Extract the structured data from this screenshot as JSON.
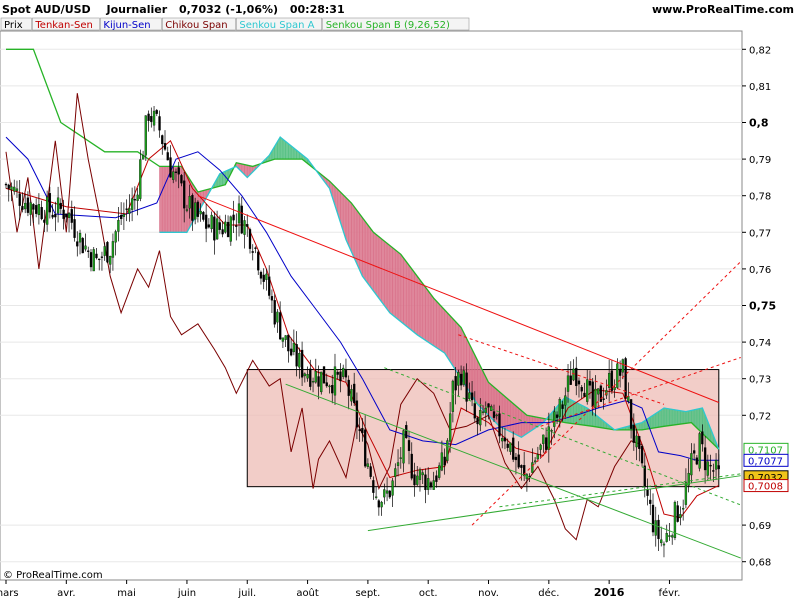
{
  "header": {
    "instrument": "Spot AUD/USD",
    "period": "Journalier",
    "last": "0,7032 (-1,06%)",
    "time": "00:28:31",
    "site": "www.ProRealTime.com"
  },
  "legend": [
    {
      "label": "Prix",
      "color": "#000000"
    },
    {
      "label": "Tenkan-Sen",
      "color": "#c00000"
    },
    {
      "label": "Kijun-Sen",
      "color": "#0000c8"
    },
    {
      "label": "Chikou Span",
      "color": "#7a0000"
    },
    {
      "label": "Senkou Span A",
      "color": "#2ec7d0"
    },
    {
      "label": "Senkou Span B (9,26,52)",
      "color": "#27b327"
    }
  ],
  "copyright": "© ProRealTime.com",
  "colors": {
    "bull": "#1a9a1a",
    "bear": "#000000",
    "cloud_bear": "#d9728a",
    "cloud_bull": "#55c083",
    "span_a": "#2ec7d0",
    "span_b": "#27b327",
    "tenkan": "#c00000",
    "kijun": "#0000c8",
    "chikou": "#7a0000",
    "range_box": "#eebcb6",
    "trend_red": "#ee1111",
    "trend_green": "#33aa33"
  },
  "chart_data": {
    "type": "candlestick",
    "x_labels": [
      "mars",
      "avr.",
      "mai",
      "juin",
      "juil.",
      "août",
      "sept.",
      "oct.",
      "nov.",
      "déc.",
      "2016",
      "févr."
    ],
    "y_range": [
      0.675,
      0.825
    ],
    "y_ticks": [
      {
        "label": "0,82",
        "value": 0.82,
        "bold": false
      },
      {
        "label": "0,81",
        "value": 0.81,
        "bold": false
      },
      {
        "label": "0,8",
        "value": 0.8,
        "bold": true
      },
      {
        "label": "0,79",
        "value": 0.79,
        "bold": false
      },
      {
        "label": "0,78",
        "value": 0.78,
        "bold": false
      },
      {
        "label": "0,77",
        "value": 0.77,
        "bold": false
      },
      {
        "label": "0,76",
        "value": 0.76,
        "bold": false
      },
      {
        "label": "0,75",
        "value": 0.75,
        "bold": true
      },
      {
        "label": "0,74",
        "value": 0.74,
        "bold": false
      },
      {
        "label": "0,73",
        "value": 0.73,
        "bold": false
      },
      {
        "label": "0,72",
        "value": 0.72,
        "bold": false
      },
      {
        "label": "0,69",
        "value": 0.69,
        "bold": false
      },
      {
        "label": "0,68",
        "value": 0.68,
        "bold": false
      }
    ],
    "badges": [
      {
        "label": "0,7107",
        "value": 0.7107,
        "bg": "#ffffff",
        "fg": "#27b327",
        "border": "#27b327"
      },
      {
        "label": "0,7077",
        "value": 0.7077,
        "bg": "#ffffff",
        "fg": "#0000c8",
        "border": "#0000c8"
      },
      {
        "label": "0,7032",
        "value": 0.7032,
        "bg": "#f0c419",
        "fg": "#000000",
        "border": "#000000"
      },
      {
        "label": "0,7008",
        "value": 0.7008,
        "bg": "#ffffff",
        "fg": "#c00000",
        "border": "#c00000"
      }
    ],
    "month_index": [
      0,
      22,
      44,
      66,
      88,
      110,
      132,
      154,
      176,
      198,
      220,
      242
    ],
    "total_bars": 268,
    "close_anchors": [
      [
        0,
        0.783
      ],
      [
        8,
        0.778
      ],
      [
        15,
        0.776
      ],
      [
        22,
        0.776
      ],
      [
        28,
        0.767
      ],
      [
        33,
        0.762
      ],
      [
        38,
        0.766
      ],
      [
        42,
        0.774
      ],
      [
        47,
        0.779
      ],
      [
        52,
        0.803
      ],
      [
        56,
        0.798
      ],
      [
        60,
        0.788
      ],
      [
        64,
        0.781
      ],
      [
        68,
        0.775
      ],
      [
        73,
        0.772
      ],
      [
        78,
        0.771
      ],
      [
        85,
        0.775
      ],
      [
        90,
        0.768
      ],
      [
        94,
        0.758
      ],
      [
        98,
        0.748
      ],
      [
        103,
        0.738
      ],
      [
        108,
        0.733
      ],
      [
        113,
        0.731
      ],
      [
        118,
        0.73
      ],
      [
        124,
        0.729
      ],
      [
        128,
        0.718
      ],
      [
        132,
        0.707
      ],
      [
        135,
        0.699
      ],
      [
        138,
        0.697
      ],
      [
        141,
        0.701
      ],
      [
        145,
        0.712
      ],
      [
        149,
        0.704
      ],
      [
        152,
        0.703
      ],
      [
        155,
        0.702
      ],
      [
        160,
        0.707
      ],
      [
        163,
        0.727
      ],
      [
        166,
        0.732
      ],
      [
        169,
        0.724
      ],
      [
        172,
        0.716
      ],
      [
        175,
        0.722
      ],
      [
        178,
        0.717
      ],
      [
        182,
        0.715
      ],
      [
        186,
        0.708
      ],
      [
        189,
        0.702
      ],
      [
        192,
        0.707
      ],
      [
        196,
        0.712
      ],
      [
        200,
        0.718
      ],
      [
        203,
        0.723
      ],
      [
        207,
        0.733
      ],
      [
        211,
        0.729
      ],
      [
        214,
        0.722
      ],
      [
        218,
        0.727
      ],
      [
        221,
        0.73
      ],
      [
        225,
        0.732
      ],
      [
        228,
        0.718
      ],
      [
        231,
        0.707
      ],
      [
        234,
        0.697
      ],
      [
        237,
        0.688
      ],
      [
        240,
        0.685
      ],
      [
        243,
        0.691
      ],
      [
        247,
        0.697
      ],
      [
        250,
        0.706
      ],
      [
        253,
        0.712
      ],
      [
        256,
        0.706
      ],
      [
        258,
        0.705
      ],
      [
        260,
        0.703
      ]
    ],
    "tenkan": [
      [
        0,
        0.782
      ],
      [
        22,
        0.777
      ],
      [
        44,
        0.775
      ],
      [
        52,
        0.79
      ],
      [
        60,
        0.795
      ],
      [
        68,
        0.782
      ],
      [
        80,
        0.772
      ],
      [
        88,
        0.772
      ],
      [
        95,
        0.76
      ],
      [
        103,
        0.742
      ],
      [
        113,
        0.732
      ],
      [
        124,
        0.729
      ],
      [
        132,
        0.715
      ],
      [
        140,
        0.703
      ],
      [
        150,
        0.705
      ],
      [
        160,
        0.706
      ],
      [
        166,
        0.722
      ],
      [
        176,
        0.718
      ],
      [
        186,
        0.711
      ],
      [
        196,
        0.709
      ],
      [
        205,
        0.722
      ],
      [
        215,
        0.727
      ],
      [
        225,
        0.726
      ],
      [
        233,
        0.71
      ],
      [
        240,
        0.693
      ],
      [
        246,
        0.692
      ],
      [
        252,
        0.698
      ],
      [
        260,
        0.7008
      ]
    ],
    "kijun": [
      [
        0,
        0.796
      ],
      [
        8,
        0.79
      ],
      [
        18,
        0.775
      ],
      [
        40,
        0.774
      ],
      [
        55,
        0.778
      ],
      [
        62,
        0.79
      ],
      [
        70,
        0.792
      ],
      [
        78,
        0.787
      ],
      [
        86,
        0.78
      ],
      [
        95,
        0.77
      ],
      [
        104,
        0.758
      ],
      [
        112,
        0.75
      ],
      [
        122,
        0.74
      ],
      [
        130,
        0.73
      ],
      [
        140,
        0.716
      ],
      [
        152,
        0.713
      ],
      [
        164,
        0.712
      ],
      [
        176,
        0.716
      ],
      [
        188,
        0.718
      ],
      [
        198,
        0.718
      ],
      [
        208,
        0.72
      ],
      [
        216,
        0.722
      ],
      [
        226,
        0.724
      ],
      [
        232,
        0.722
      ],
      [
        238,
        0.71
      ],
      [
        246,
        0.709
      ],
      [
        252,
        0.7077
      ],
      [
        260,
        0.7077
      ]
    ],
    "span_a": [
      [
        56,
        0.77
      ],
      [
        66,
        0.77
      ],
      [
        72,
        0.778
      ],
      [
        78,
        0.786
      ],
      [
        84,
        0.788
      ],
      [
        88,
        0.785
      ],
      [
        96,
        0.791
      ],
      [
        100,
        0.796
      ],
      [
        110,
        0.79
      ],
      [
        118,
        0.782
      ],
      [
        124,
        0.768
      ],
      [
        130,
        0.758
      ],
      [
        140,
        0.748
      ],
      [
        150,
        0.742
      ],
      [
        160,
        0.737
      ],
      [
        172,
        0.723
      ],
      [
        180,
        0.717
      ],
      [
        188,
        0.714
      ],
      [
        196,
        0.718
      ],
      [
        204,
        0.725
      ],
      [
        212,
        0.722
      ],
      [
        222,
        0.716
      ],
      [
        232,
        0.718
      ],
      [
        240,
        0.722
      ],
      [
        248,
        0.721
      ],
      [
        254,
        0.722
      ],
      [
        260,
        0.7107
      ]
    ],
    "span_b": [
      [
        0,
        0.82
      ],
      [
        10,
        0.82
      ],
      [
        20,
        0.8
      ],
      [
        36,
        0.792
      ],
      [
        48,
        0.792
      ],
      [
        56,
        0.788
      ],
      [
        64,
        0.788
      ],
      [
        70,
        0.781
      ],
      [
        80,
        0.783
      ],
      [
        84,
        0.789
      ],
      [
        90,
        0.788
      ],
      [
        98,
        0.79
      ],
      [
        108,
        0.79
      ],
      [
        118,
        0.784
      ],
      [
        126,
        0.778
      ],
      [
        134,
        0.77
      ],
      [
        144,
        0.764
      ],
      [
        156,
        0.752
      ],
      [
        166,
        0.744
      ],
      [
        176,
        0.729
      ],
      [
        190,
        0.72
      ],
      [
        204,
        0.718
      ],
      [
        214,
        0.717
      ],
      [
        222,
        0.716
      ],
      [
        232,
        0.716
      ],
      [
        240,
        0.717
      ],
      [
        250,
        0.718
      ],
      [
        260,
        0.7107
      ]
    ],
    "chikou": [
      [
        0,
        0.792
      ],
      [
        4,
        0.77
      ],
      [
        8,
        0.785
      ],
      [
        12,
        0.76
      ],
      [
        18,
        0.795
      ],
      [
        22,
        0.77
      ],
      [
        26,
        0.808
      ],
      [
        30,
        0.79
      ],
      [
        34,
        0.775
      ],
      [
        38,
        0.758
      ],
      [
        42,
        0.748
      ],
      [
        48,
        0.76
      ],
      [
        52,
        0.755
      ],
      [
        56,
        0.765
      ],
      [
        60,
        0.747
      ],
      [
        64,
        0.742
      ],
      [
        70,
        0.745
      ],
      [
        76,
        0.738
      ],
      [
        80,
        0.733
      ],
      [
        84,
        0.726
      ],
      [
        90,
        0.735
      ],
      [
        96,
        0.728
      ],
      [
        100,
        0.73
      ],
      [
        104,
        0.71
      ],
      [
        108,
        0.722
      ],
      [
        112,
        0.7
      ],
      [
        114,
        0.708
      ],
      [
        118,
        0.713
      ],
      [
        124,
        0.703
      ],
      [
        128,
        0.718
      ],
      [
        132,
        0.712
      ],
      [
        136,
        0.7
      ],
      [
        140,
        0.706
      ],
      [
        144,
        0.723
      ],
      [
        150,
        0.73
      ],
      [
        156,
        0.726
      ],
      [
        162,
        0.716
      ],
      [
        168,
        0.717
      ],
      [
        176,
        0.72
      ],
      [
        182,
        0.707
      ],
      [
        188,
        0.7
      ],
      [
        194,
        0.706
      ],
      [
        200,
        0.697
      ],
      [
        204,
        0.689
      ],
      [
        208,
        0.686
      ],
      [
        212,
        0.697
      ],
      [
        216,
        0.695
      ],
      [
        222,
        0.706
      ],
      [
        228,
        0.713
      ],
      [
        232,
        0.712
      ]
    ],
    "range_box": {
      "x0": 88,
      "x1": 260,
      "y0": 0.7005,
      "y1": 0.7325
    },
    "lines": [
      {
        "style": "solid",
        "color": "trend_red",
        "pts": [
          [
            70,
            0.78
          ],
          [
            260,
            0.7235
          ]
        ]
      },
      {
        "style": "dashed",
        "color": "trend_red",
        "pts": [
          [
            165,
            0.742
          ],
          [
            240,
            0.723
          ]
        ]
      },
      {
        "style": "dashed",
        "color": "trend_red",
        "pts": [
          [
            170,
            0.69
          ],
          [
            268,
            0.762
          ]
        ]
      },
      {
        "style": "dashed",
        "color": "trend_red",
        "pts": [
          [
            195,
            0.717
          ],
          [
            268,
            0.7358
          ]
        ]
      },
      {
        "style": "solid",
        "color": "trend_green",
        "pts": [
          [
            102,
            0.7285
          ],
          [
            268,
            0.681
          ]
        ]
      },
      {
        "style": "dashed",
        "color": "trend_green",
        "pts": [
          [
            138,
            0.733
          ],
          [
            268,
            0.6955
          ]
        ]
      },
      {
        "style": "solid",
        "color": "trend_green",
        "pts": [
          [
            132,
            0.6885
          ],
          [
            268,
            0.7035
          ]
        ]
      },
      {
        "style": "dashed",
        "color": "trend_green",
        "pts": [
          [
            180,
            0.695
          ],
          [
            268,
            0.704
          ]
        ]
      }
    ]
  }
}
